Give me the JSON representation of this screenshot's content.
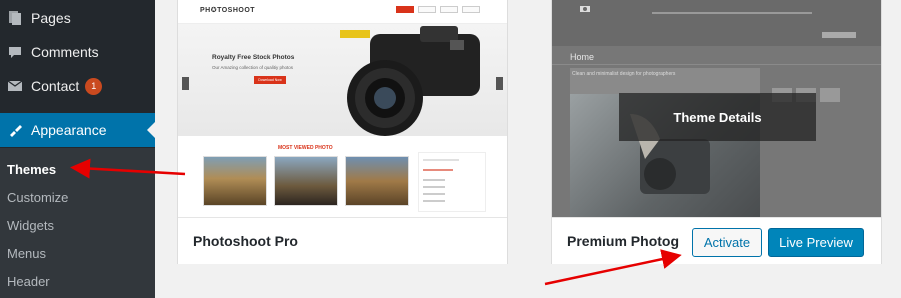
{
  "sidebar": {
    "items": [
      {
        "label": "Pages",
        "icon": "pages-icon"
      },
      {
        "label": "Comments",
        "icon": "comments-icon"
      },
      {
        "label": "Contact",
        "icon": "mail-icon",
        "badge": "1"
      },
      {
        "label": "Appearance",
        "icon": "brush-icon"
      }
    ],
    "submenu": [
      "Themes",
      "Customize",
      "Widgets",
      "Menus",
      "Header"
    ],
    "current_submenu": "Themes"
  },
  "themes": [
    {
      "name": "Photoshoot Pro",
      "screenshot": {
        "logo": "PH✪TOSHOOT",
        "hero_title": "Royalty Free Stock Photos",
        "hero_sub": "Our Amazing collection of qualitiy photos",
        "hero_button": "Download Now",
        "section_title": "MOST VIEWED PHOTO"
      }
    },
    {
      "name": "Premium Photography",
      "screenshot": {
        "home_label": "Home",
        "post_title": "Clean and minimalist design for photographers"
      },
      "overlay_label": "Theme Details",
      "activate_label": "Activate",
      "preview_label": "Live Preview"
    }
  ],
  "colors": {
    "sidebar_bg": "#23282d",
    "active_bg": "#0073aa",
    "primary_button": "#0085ba",
    "annotation_arrow": "#e60000"
  }
}
